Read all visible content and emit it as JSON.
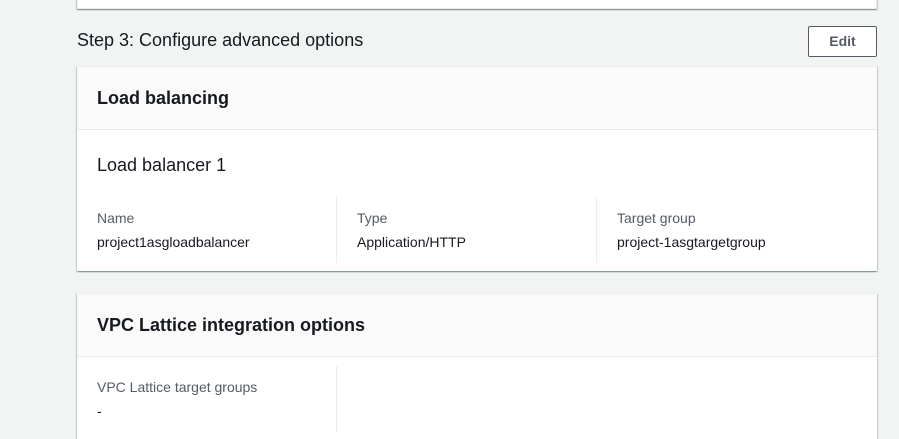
{
  "step": {
    "title": "Step 3: Configure advanced options",
    "edit_label": "Edit"
  },
  "load_balancing": {
    "header": "Load balancing",
    "subtitle": "Load balancer 1",
    "fields": [
      {
        "label": "Name",
        "value": "project1asgloadbalancer"
      },
      {
        "label": "Type",
        "value": "Application/HTTP"
      },
      {
        "label": "Target group",
        "value": "project-1asgtargetgroup"
      }
    ]
  },
  "vpc_lattice": {
    "header": "VPC Lattice integration options",
    "fields": [
      {
        "label": "VPC Lattice target groups",
        "value": "-"
      }
    ]
  }
}
